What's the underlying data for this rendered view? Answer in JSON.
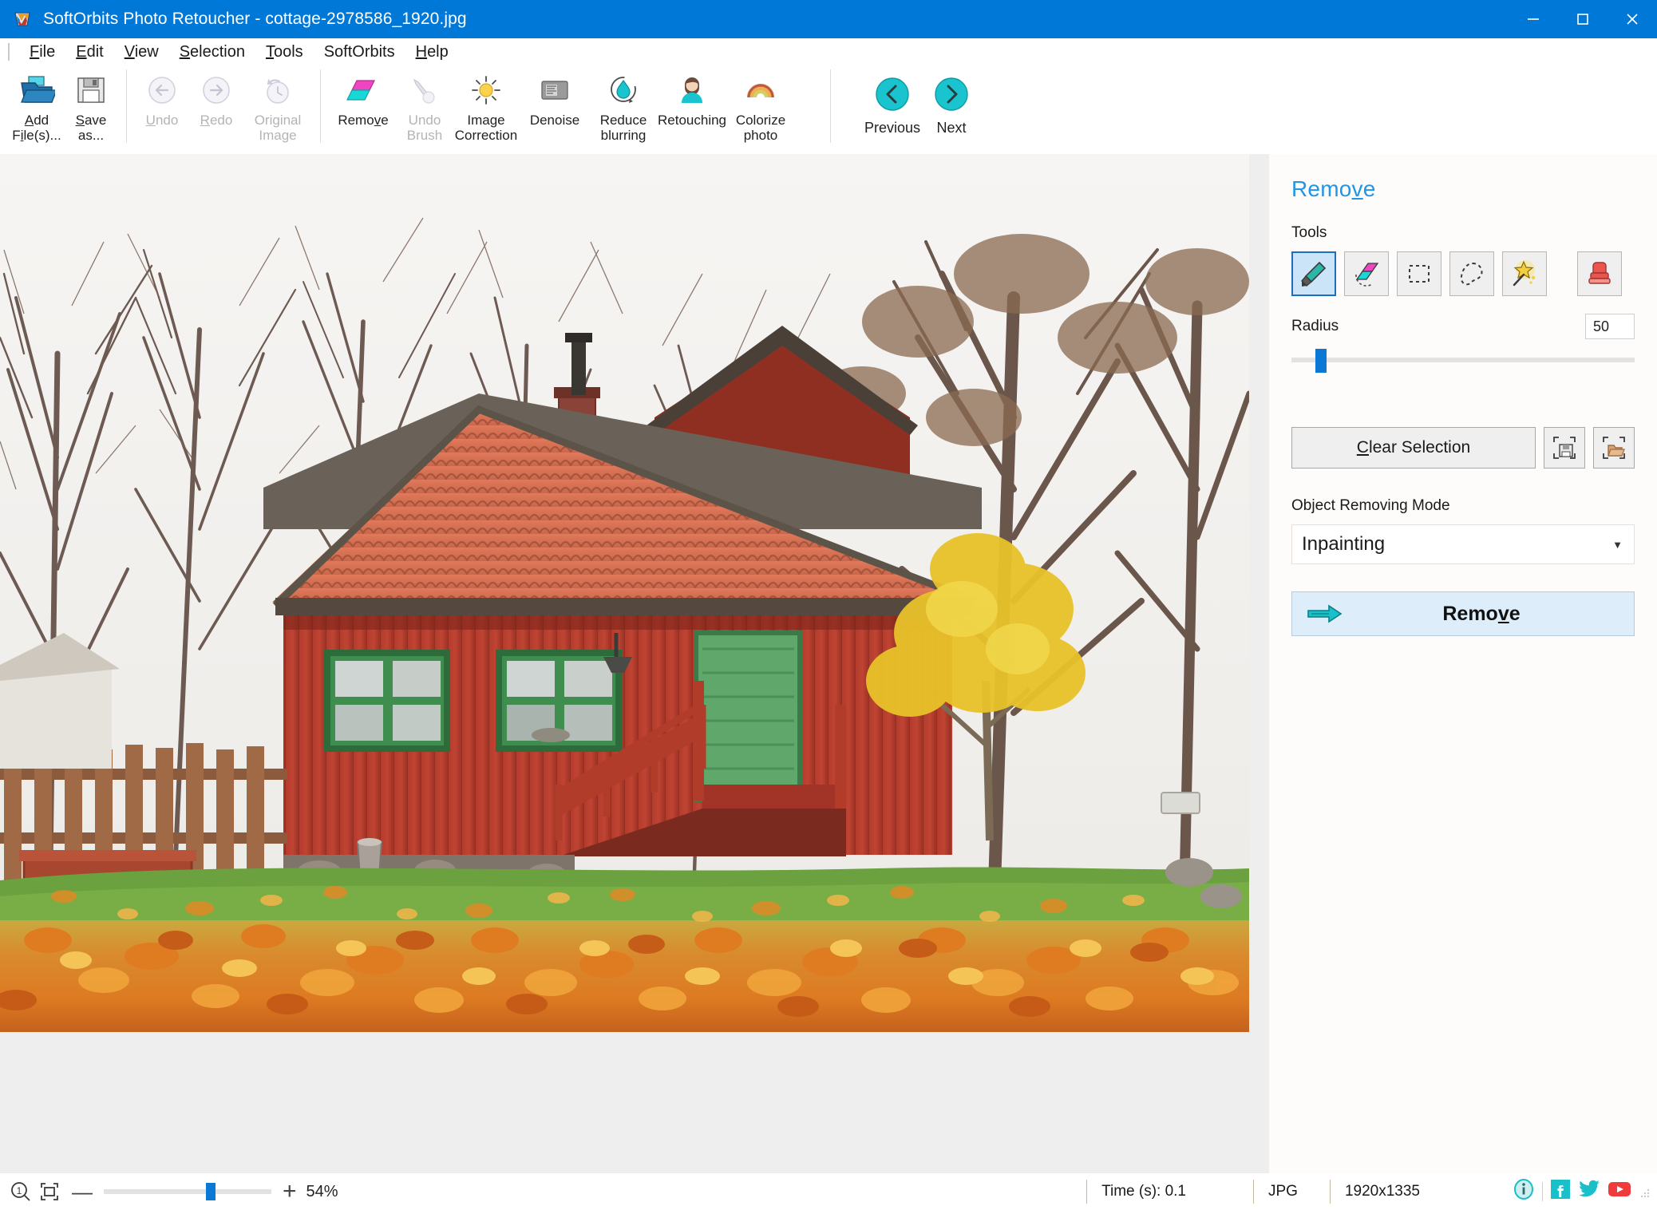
{
  "window": {
    "title": "SoftOrbits Photo Retoucher - cottage-2978586_1920.jpg",
    "app_icon": "softorbits-logo-icon",
    "titlebar_color": "#0078d7",
    "minimize": "minimize-icon",
    "maximize": "maximize-icon",
    "close": "close-icon"
  },
  "menubar": {
    "items": [
      {
        "label": "File",
        "accel": "F"
      },
      {
        "label": "Edit",
        "accel": "E"
      },
      {
        "label": "View",
        "accel": "V"
      },
      {
        "label": "Selection",
        "accel": "S"
      },
      {
        "label": "Tools",
        "accel": "T"
      },
      {
        "label": "SoftOrbits",
        "accel": ""
      },
      {
        "label": "Help",
        "accel": "H"
      }
    ]
  },
  "toolbar": {
    "groups": [
      {
        "buttons": [
          {
            "label_line1": "Add",
            "label_line2": "File(s)...",
            "icon": "open-folder-icon",
            "enabled": true,
            "accel": "F"
          },
          {
            "label_line1": "Save",
            "label_line2": "as...",
            "icon": "floppy-save-icon",
            "enabled": true,
            "accel": "S"
          }
        ]
      },
      {
        "buttons": [
          {
            "label_line1": "Undo",
            "label_line2": "",
            "icon": "undo-arrow-icon",
            "enabled": false,
            "accel": "U"
          },
          {
            "label_line1": "Redo",
            "label_line2": "",
            "icon": "redo-arrow-icon",
            "enabled": false,
            "accel": "R"
          },
          {
            "label_line1": "Original",
            "label_line2": "Image",
            "icon": "original-image-icon",
            "enabled": false,
            "accel": ""
          }
        ]
      },
      {
        "buttons": [
          {
            "label_line1": "Remove",
            "label_line2": "",
            "icon": "remove-shape-icon",
            "enabled": true,
            "accel": "v"
          },
          {
            "label_line1": "Undo",
            "label_line2": "Brush",
            "icon": "undo-brush-icon",
            "enabled": false,
            "accel": ""
          },
          {
            "label_line1": "Image",
            "label_line2": "Correction",
            "icon": "brightness-sun-icon",
            "enabled": true,
            "accel": ""
          },
          {
            "label_line1": "Denoise",
            "label_line2": "",
            "icon": "denoise-icon",
            "enabled": true,
            "accel": ""
          },
          {
            "label_line1": "Reduce",
            "label_line2": "blurring",
            "icon": "reduce-blurring-icon",
            "enabled": true,
            "accel": ""
          },
          {
            "label_line1": "Retouching",
            "label_line2": "",
            "icon": "retouching-person-icon",
            "enabled": true,
            "accel": ""
          },
          {
            "label_line1": "Colorize",
            "label_line2": "photo",
            "icon": "colorize-rainbow-icon",
            "enabled": true,
            "accel": ""
          }
        ]
      },
      {
        "buttons": [
          {
            "label_line1": "Previous",
            "label_line2": "",
            "icon": "previous-circle-icon",
            "enabled": true,
            "accel": ""
          },
          {
            "label_line1": "Next",
            "label_line2": "",
            "icon": "next-circle-icon",
            "enabled": true,
            "accel": ""
          }
        ]
      }
    ]
  },
  "panel": {
    "title": "Remove",
    "title_accel": "v",
    "tools_label": "Tools",
    "tools": [
      {
        "name": "brush-tool",
        "icon": "marker-brush-icon",
        "selected": true
      },
      {
        "name": "eraser-tool",
        "icon": "eraser-icon",
        "selected": false
      },
      {
        "name": "rectangle-select",
        "icon": "rectangle-select-icon",
        "selected": false
      },
      {
        "name": "lasso-select",
        "icon": "lasso-icon",
        "selected": false
      },
      {
        "name": "magic-wand",
        "icon": "magic-wand-icon",
        "selected": false
      },
      {
        "name": "clone-stamp",
        "icon": "clone-stamp-icon",
        "selected": false
      }
    ],
    "radius_label": "Radius",
    "radius_value": "50",
    "radius_percent": 7,
    "clear_selection_label": "Clear Selection",
    "clear_selection_accel": "C",
    "save_selection_icon": "save-selection-icon",
    "load_selection_icon": "load-selection-icon",
    "mode_label": "Object Removing Mode",
    "mode_value": "Inpainting",
    "remove_button_label": "Remove",
    "remove_button_accel": "v",
    "remove_button_icon": "arrow-right-icon",
    "accent_color": "#2196e8",
    "remove_button_bg": "#ddeefa"
  },
  "statusbar": {
    "zoom_icon": "zoom-one-to-one-icon",
    "fit_icon": "fit-to-window-icon",
    "minus_icon": "zoom-out-icon",
    "plus_icon": "zoom-in-icon",
    "zoom_percent": "54%",
    "zoom_slider_percent": 61,
    "time_label": "Time (s): 0.1",
    "format_label": "JPG",
    "dimensions_label": "1920x1335",
    "social": [
      {
        "name": "info-icon",
        "glyph": "i"
      },
      {
        "name": "facebook-icon",
        "glyph": "f"
      },
      {
        "name": "twitter-icon",
        "glyph": "t"
      },
      {
        "name": "youtube-icon",
        "glyph": "y"
      }
    ],
    "resize_grip": "resize-grip-icon"
  },
  "canvas": {
    "image_name": "cottage-2978586_1920.jpg",
    "description": "Red Swedish wooden cottage with orange tile roof, green window frames and green door, bare autumn trees, yellow-leaved small tree and ground covered in orange fallen leaves",
    "background_color": "#eeeeee"
  }
}
